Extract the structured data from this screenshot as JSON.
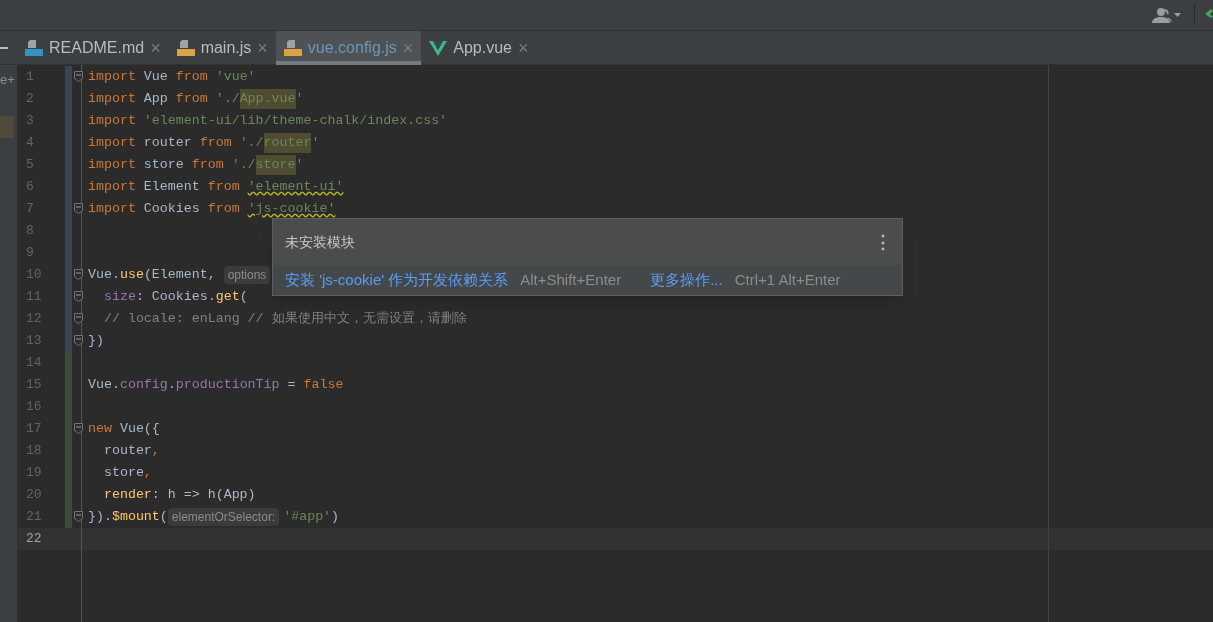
{
  "sidebar": {
    "marker": "e+"
  },
  "tabs": [
    {
      "label": "README.md",
      "kind": "md",
      "selected": false
    },
    {
      "label": "main.js",
      "kind": "js",
      "selected": false
    },
    {
      "label": "vue.config.js",
      "kind": "js",
      "selected": true
    },
    {
      "label": "App.vue",
      "kind": "vue",
      "selected": false
    }
  ],
  "close_glyph": "×",
  "lines": [
    {
      "number": "1",
      "modified": true,
      "added": false,
      "fold": true,
      "current": false,
      "tokens": [
        {
          "kind": "keyword",
          "text": "import"
        },
        {
          "kind": "plain",
          "text": " Vue "
        },
        {
          "kind": "keyword",
          "text": "from"
        },
        {
          "kind": "string",
          "text": " 'vue'"
        }
      ]
    },
    {
      "number": "2",
      "modified": true,
      "added": false,
      "fold": false,
      "current": false,
      "tokens": [
        {
          "kind": "keyword",
          "text": "import"
        },
        {
          "kind": "plain",
          "text": " App "
        },
        {
          "kind": "keyword",
          "text": "from"
        },
        {
          "kind": "string",
          "text": " './"
        },
        {
          "kind": "string-hl",
          "text": "App.vue"
        },
        {
          "kind": "string",
          "text": "'"
        }
      ]
    },
    {
      "number": "3",
      "modified": true,
      "added": false,
      "fold": false,
      "current": false,
      "tokens": [
        {
          "kind": "keyword",
          "text": "import"
        },
        {
          "kind": "string",
          "text": " 'element-ui/lib/theme-chalk/index.css'"
        }
      ]
    },
    {
      "number": "4",
      "modified": true,
      "added": false,
      "fold": false,
      "current": false,
      "tokens": [
        {
          "kind": "keyword",
          "text": "import"
        },
        {
          "kind": "plain",
          "text": " router "
        },
        {
          "kind": "keyword",
          "text": "from"
        },
        {
          "kind": "string",
          "text": " './"
        },
        {
          "kind": "string-hl",
          "text": "router"
        },
        {
          "kind": "string",
          "text": "'"
        }
      ]
    },
    {
      "number": "5",
      "modified": true,
      "added": false,
      "fold": false,
      "current": false,
      "tokens": [
        {
          "kind": "keyword",
          "text": "import"
        },
        {
          "kind": "plain",
          "text": " store "
        },
        {
          "kind": "keyword",
          "text": "from"
        },
        {
          "kind": "string",
          "text": " './"
        },
        {
          "kind": "string-hl",
          "text": "store"
        },
        {
          "kind": "string",
          "text": "'"
        }
      ]
    },
    {
      "number": "6",
      "modified": true,
      "added": false,
      "fold": false,
      "current": false,
      "tokens": [
        {
          "kind": "keyword",
          "text": "import"
        },
        {
          "kind": "plain",
          "text": " Element "
        },
        {
          "kind": "keyword",
          "text": "from "
        },
        {
          "kind": "string-warn",
          "text": "'element-ui'"
        }
      ]
    },
    {
      "number": "7",
      "modified": true,
      "added": false,
      "fold": true,
      "current": false,
      "tokens": [
        {
          "kind": "keyword",
          "text": "import"
        },
        {
          "kind": "plain",
          "text": " Cookies "
        },
        {
          "kind": "keyword",
          "text": "from "
        },
        {
          "kind": "string-warn",
          "text": "'js-cookie'"
        }
      ]
    },
    {
      "number": "8",
      "modified": true,
      "added": false,
      "fold": false,
      "current": false
    },
    {
      "number": "9",
      "modified": true,
      "added": false,
      "fold": false,
      "current": false
    },
    {
      "number": "10",
      "modified": true,
      "added": false,
      "fold": true,
      "current": false,
      "tokens": [
        {
          "kind": "plain",
          "text": "Vue."
        },
        {
          "kind": "method",
          "text": "use"
        },
        {
          "kind": "plain",
          "text": "(Element, "
        },
        {
          "kind": "hint",
          "text": "options"
        }
      ]
    },
    {
      "number": "11",
      "modified": true,
      "added": false,
      "fold": true,
      "current": false,
      "tokens": [
        {
          "kind": "prop",
          "text": "  size"
        },
        {
          "kind": "plain",
          "text": ": Cookies."
        },
        {
          "kind": "method",
          "text": "get"
        },
        {
          "kind": "plain",
          "text": "("
        }
      ]
    },
    {
      "number": "12",
      "modified": true,
      "added": false,
      "fold": true,
      "current": false,
      "tokens": [
        {
          "kind": "comment",
          "text": "  // locale: enLang // 如果使用中文，无需设置，请删除"
        }
      ]
    },
    {
      "number": "13",
      "modified": true,
      "added": false,
      "fold": true,
      "current": false,
      "tokens": [
        {
          "kind": "plain",
          "text": "})"
        }
      ]
    },
    {
      "number": "14",
      "modified": false,
      "added": true,
      "fold": false,
      "current": false
    },
    {
      "number": "15",
      "modified": false,
      "added": true,
      "fold": false,
      "current": false,
      "tokens": [
        {
          "kind": "plain",
          "text": "Vue."
        },
        {
          "kind": "prop",
          "text": "config"
        },
        {
          "kind": "plain",
          "text": "."
        },
        {
          "kind": "prop",
          "text": "productionTip"
        },
        {
          "kind": "plain",
          "text": " = "
        },
        {
          "kind": "keyword",
          "text": "false"
        }
      ]
    },
    {
      "number": "16",
      "modified": false,
      "added": true,
      "fold": false,
      "current": false
    },
    {
      "number": "17",
      "modified": false,
      "added": true,
      "fold": true,
      "current": false,
      "tokens": [
        {
          "kind": "keyword",
          "text": "new"
        },
        {
          "kind": "plain",
          "text": " Vue({"
        }
      ]
    },
    {
      "number": "18",
      "modified": false,
      "added": true,
      "fold": false,
      "current": false,
      "tokens": [
        {
          "kind": "plain",
          "text": "  router"
        },
        {
          "kind": "keyword",
          "text": ","
        }
      ]
    },
    {
      "number": "19",
      "modified": false,
      "added": true,
      "fold": false,
      "current": false,
      "tokens": [
        {
          "kind": "plain",
          "text": "  store"
        },
        {
          "kind": "keyword",
          "text": ","
        }
      ]
    },
    {
      "number": "20",
      "modified": false,
      "added": true,
      "fold": false,
      "current": false,
      "tokens": [
        {
          "kind": "method",
          "text": "  render"
        },
        {
          "kind": "plain",
          "text": ": h => h(App)"
        }
      ]
    },
    {
      "number": "21",
      "modified": false,
      "added": true,
      "fold": true,
      "current": false,
      "tokens": [
        {
          "kind": "plain",
          "text": "})."
        },
        {
          "kind": "method",
          "text": "$mount"
        },
        {
          "kind": "plain",
          "text": "("
        },
        {
          "kind": "hint",
          "text": "elementOrSelector:"
        },
        {
          "kind": "string",
          "text": "'#app'"
        },
        {
          "kind": "plain",
          "text": ")"
        }
      ]
    },
    {
      "number": "22",
      "modified": false,
      "added": false,
      "fold": false,
      "current": true
    }
  ],
  "popup": {
    "title": "未安装模块",
    "menu_glyph": "⋮",
    "actions": [
      {
        "label": "安装 'js-cookie' 作为开发依赖关系",
        "shortcut": "Alt+Shift+Enter"
      },
      {
        "label": "更多操作...",
        "shortcut": "Ctrl+1 Alt+Enter"
      }
    ]
  }
}
